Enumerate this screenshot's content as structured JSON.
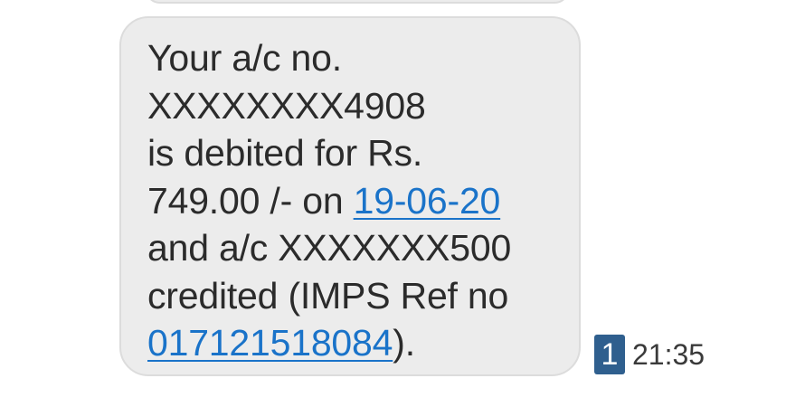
{
  "message": {
    "line1": "Your a/c no.",
    "line2": "XXXXXXXX4908",
    "line3": "is debited for Rs.",
    "line4_text": "749.00 /- on ",
    "line4_date_link": "19-06-20",
    "line5": "and a/c XXXXXXX500",
    "line6": "credited (IMPS Ref no",
    "line7_ref_link": "017121518084",
    "line7_suffix": ")."
  },
  "meta": {
    "sim_badge": "1",
    "time": "21:35"
  },
  "colors": {
    "bubble": "#ececec",
    "link": "#1a73c9",
    "sim_badge": "#2f5f8e"
  }
}
